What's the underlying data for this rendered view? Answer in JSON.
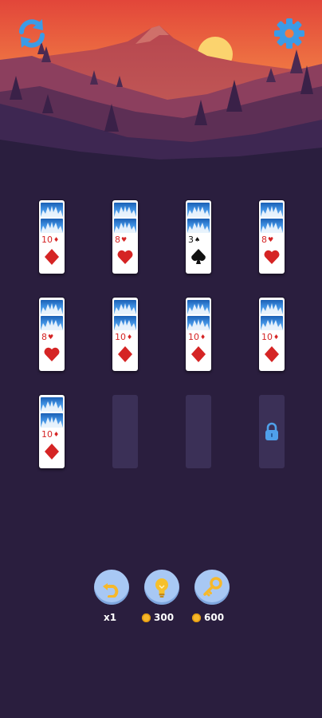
{
  "toolbar": {
    "refresh_icon": "refresh-icon",
    "settings_icon": "gear-icon"
  },
  "tableau": {
    "rows": [
      [
        {
          "rank": "10",
          "suit": "diamond",
          "color": "red",
          "facedown": 2
        },
        {
          "rank": "8",
          "suit": "heart",
          "color": "red",
          "facedown": 2
        },
        {
          "rank": "3",
          "suit": "spade",
          "color": "black",
          "facedown": 2
        },
        {
          "rank": "8",
          "suit": "heart",
          "color": "red",
          "facedown": 2
        }
      ],
      [
        {
          "rank": "8",
          "suit": "heart",
          "color": "red",
          "facedown": 2
        },
        {
          "rank": "10",
          "suit": "diamond",
          "color": "red",
          "facedown": 2
        },
        {
          "rank": "10",
          "suit": "diamond",
          "color": "red",
          "facedown": 2
        },
        {
          "rank": "10",
          "suit": "diamond",
          "color": "red",
          "facedown": 2
        }
      ],
      [
        {
          "rank": "10",
          "suit": "diamond",
          "color": "red",
          "facedown": 2
        },
        {
          "empty": true
        },
        {
          "empty": true
        },
        {
          "locked": true
        }
      ]
    ]
  },
  "powerups": {
    "undo": {
      "icon": "undo-icon",
      "count": "x1"
    },
    "hint": {
      "icon": "lightbulb-icon",
      "cost": "300"
    },
    "unlock": {
      "icon": "key-icon",
      "cost": "600"
    }
  },
  "colors": {
    "background": "#2a1e3e",
    "card_red": "#d52424",
    "button_blue": "#a8c8f4",
    "coin_gold": "#f6b82b"
  }
}
